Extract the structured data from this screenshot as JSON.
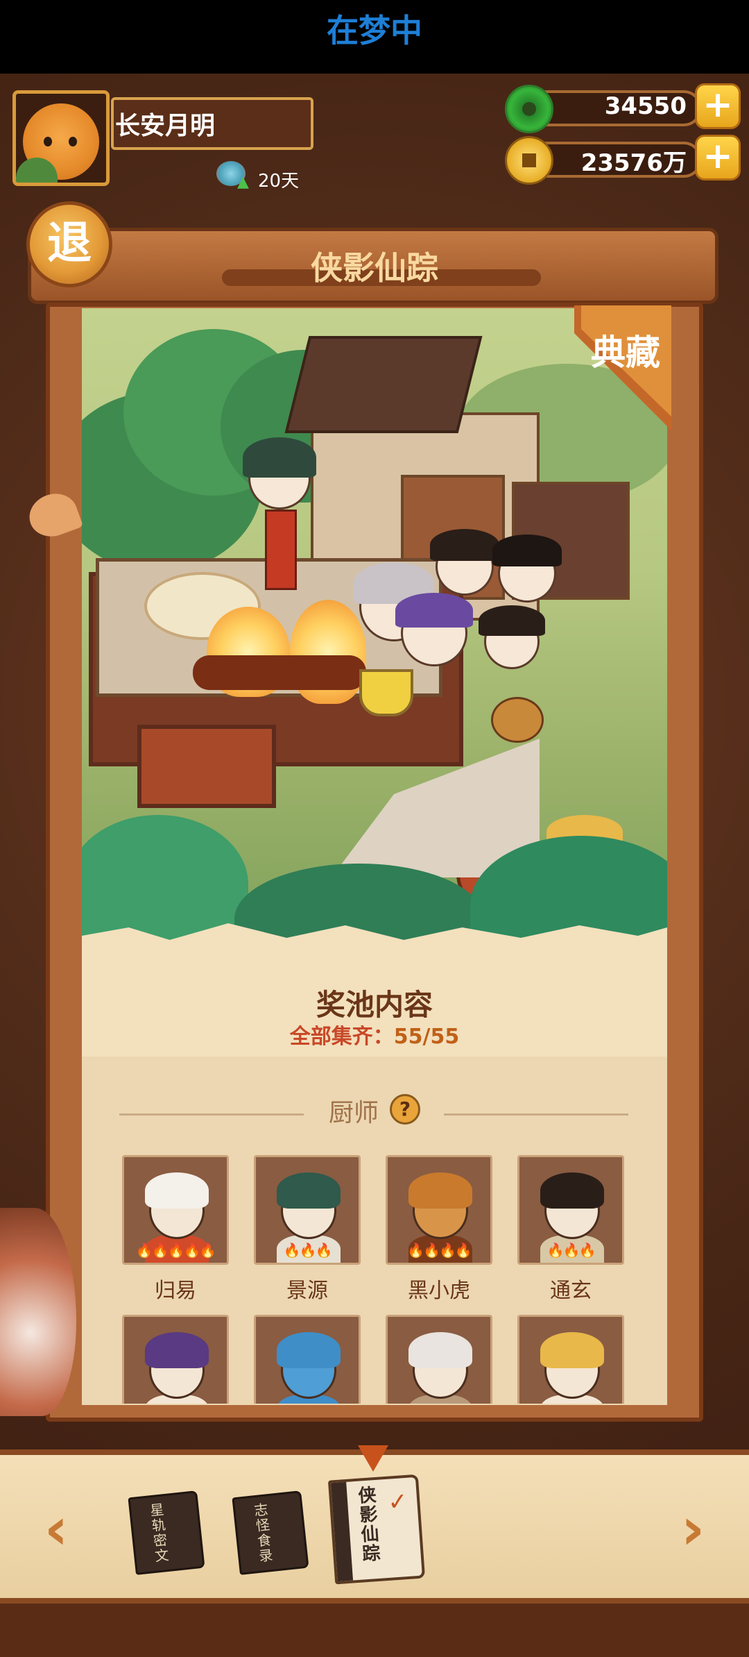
{
  "status": {
    "text": "在梦中"
  },
  "player": {
    "name": "长安月明",
    "days": "20天"
  },
  "currency": {
    "jade": {
      "amount": "34550",
      "plus": "+"
    },
    "coin": {
      "amount": "23576万",
      "plus": "+"
    }
  },
  "exit_label": "退",
  "banner_title": "侠影仙踪",
  "collection_badge": "典藏",
  "pool": {
    "title": "奖池内容",
    "collected_label": "全部集齐：",
    "collected_value": "55/55"
  },
  "chef_section": {
    "label": "厨师",
    "help": "?"
  },
  "chefs": [
    {
      "name": "归易",
      "flames": "🔥🔥🔥🔥🔥",
      "hair": "#f4f0ea",
      "body": "#d24a2a"
    },
    {
      "name": "景源",
      "flames": "🔥🔥🔥",
      "hair": "#2f5a4c",
      "body": "#e6e0d2"
    },
    {
      "name": "黑小虎",
      "flames": "🔥🔥🔥🔥",
      "hair": "#c97a2c",
      "body": "#7a3a1a"
    },
    {
      "name": "通玄",
      "flames": "🔥🔥🔥",
      "hair": "#2a1e18",
      "body": "#d8c8a6"
    },
    {
      "name": "",
      "flames": "",
      "hair": "#5a3a82",
      "body": "#f4e6d4"
    },
    {
      "name": "",
      "flames": "",
      "hair": "#3f8ec8",
      "body": "#3f8ec8"
    },
    {
      "name": "",
      "flames": "",
      "hair": "#e9e4df",
      "body": "#b89a7a"
    },
    {
      "name": "",
      "flames": "",
      "hair": "#e8b84a",
      "body": "#f4e6d4"
    }
  ],
  "books": [
    {
      "title": "星轨密文"
    },
    {
      "title": "志怪食录"
    },
    {
      "title": "侠影仙踪"
    }
  ],
  "nav": {
    "prev": "‹",
    "next": "›"
  },
  "colors": {
    "accent": "#d99a3a",
    "banner": "#9a5428",
    "card_bg": "#f3e0bd",
    "flame": "#ff8a1c"
  }
}
